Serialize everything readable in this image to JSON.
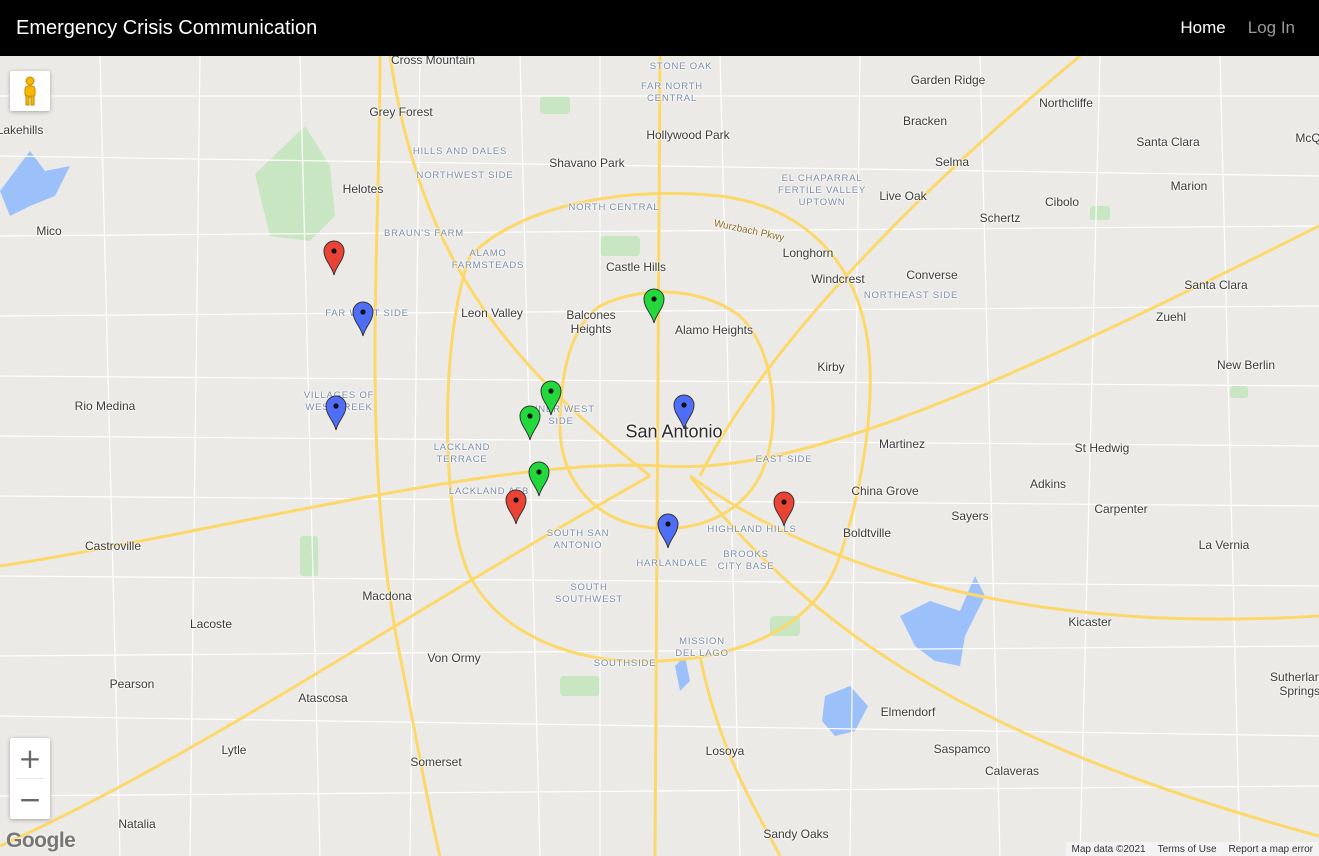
{
  "navbar": {
    "brand": "Emergency Crisis Communication",
    "links": [
      {
        "label": "Home"
      },
      {
        "label": "Log In"
      }
    ]
  },
  "map": {
    "center_label": "San Antonio",
    "cities": [
      "Cross Mountain",
      "Garden Ridge",
      "Northcliffe",
      "Lakehills",
      "Grey Forest",
      "Hollywood Park",
      "Bracken",
      "McQ",
      "Shavano Park",
      "Selma",
      "Santa Clara",
      "Helotes",
      "Live Oak",
      "Marion",
      "Cibolo",
      "Mico",
      "Schertz",
      "Longhorn",
      "Castle Hills",
      "Windcrest",
      "Converse",
      "Santa Clara",
      "Leon Valley",
      "Balcones Heights",
      "Alamo Heights",
      "Zuehl",
      "New Berlin",
      "Kirby",
      "Rio Medina",
      "Martinez",
      "St Hedwig",
      "Adkins",
      "China Grove",
      "Carpenter",
      "Sayers",
      "Boldtville",
      "Castroville",
      "La Vernia",
      "Macdona",
      "Lacoste",
      "Kicaster",
      "Von Ormy",
      "Pearson",
      "Atascosa",
      "Sutherland Springs",
      "Elmendorf",
      "Lytle",
      "Saspamco",
      "Calaveras",
      "Somerset",
      "Losoya",
      "Natalia",
      "Sandy Oaks"
    ],
    "neighborhoods": [
      "STONE OAK",
      "FAR NORTH CENTRAL",
      "HILLS AND DALES",
      "NORTHWEST SIDE",
      "EL CHAPARRAL FERTILE VALLEY UPTOWN",
      "NORTH CENTRAL",
      "BRAUN'S FARM",
      "ALAMO FARMSTEADS",
      "NORTHEAST SIDE",
      "FAR WEST SIDE",
      "VILLAGES OF WESTCREEK",
      "INNER WEST SIDE",
      "LACKLAND TERRACE",
      "EAST SIDE",
      "LACKLAND AFB",
      "HIGHLAND HILLS",
      "SOUTH SAN ANTONIO",
      "HARLANDALE",
      "BROOKS CITY BASE",
      "SOUTH SOUTHWEST",
      "MISSION DEL LAGO",
      "SOUTHSIDE"
    ],
    "roads": [
      "Wurzbach Pkwy"
    ],
    "markers": [
      {
        "color": "red"
      },
      {
        "color": "blue"
      },
      {
        "color": "blue"
      },
      {
        "color": "green"
      },
      {
        "color": "green"
      },
      {
        "color": "green"
      },
      {
        "color": "green"
      },
      {
        "color": "red"
      },
      {
        "color": "blue"
      },
      {
        "color": "blue"
      },
      {
        "color": "red"
      }
    ],
    "colors": {
      "red": "#ea4335",
      "blue": "#4f6ef7",
      "green": "#22d83a",
      "road": "#fcd86a",
      "water": "#9cc0f9",
      "park": "#c8e6c1"
    },
    "controls": {
      "zoom_in": "+",
      "zoom_out": "−",
      "pegman_icon": "pegman-icon"
    },
    "logo": "Google",
    "attribution": {
      "map_data": "Map data ©2021",
      "terms": "Terms of Use",
      "report": "Report a map error"
    }
  }
}
